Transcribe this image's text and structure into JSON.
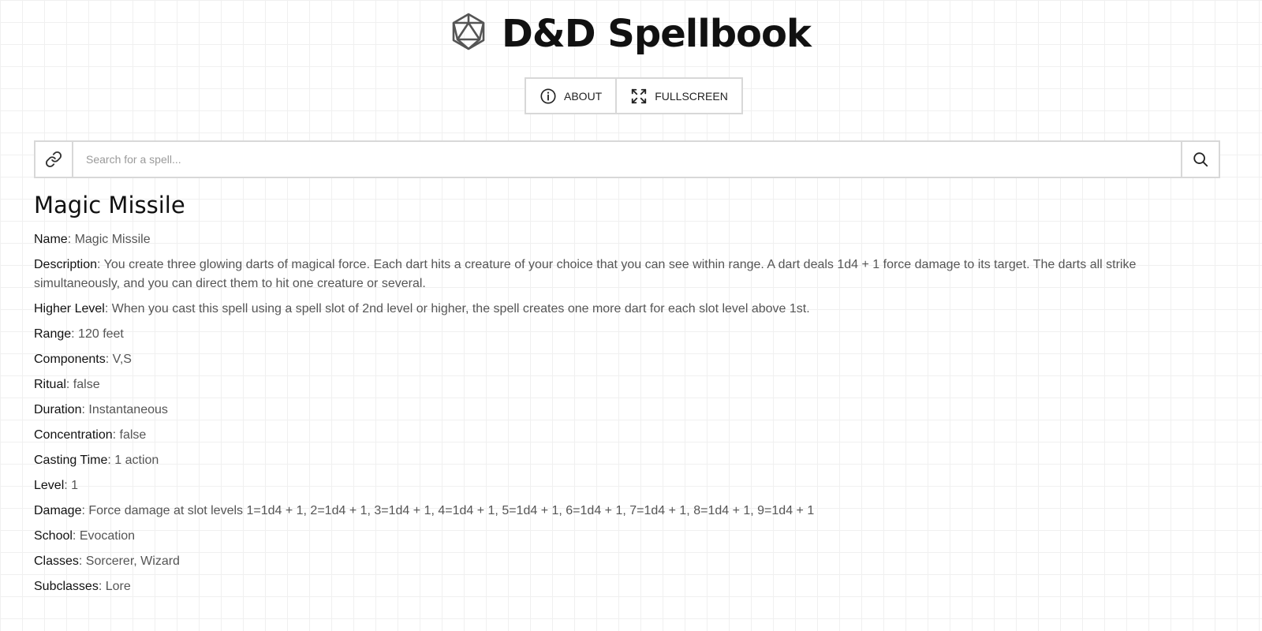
{
  "header": {
    "title": "D&D Spellbook",
    "logo_icon": "d20-icon"
  },
  "toolbar": {
    "about_label": "ABOUT",
    "about_icon": "info-icon",
    "fullscreen_label": "FULLSCREEN",
    "fullscreen_icon": "fullscreen-icon"
  },
  "search": {
    "placeholder": "Search for a spell...",
    "value": "",
    "link_icon": "link-icon",
    "search_icon": "search-icon"
  },
  "spell": {
    "title": "Magic Missile",
    "properties": [
      {
        "label": "Name",
        "value": "Magic Missile"
      },
      {
        "label": "Description",
        "value": "You create three glowing darts of magical force. Each dart hits a creature of your choice that you can see within range. A dart deals 1d4 + 1 force damage to its target. The darts all strike simultaneously, and you can direct them to hit one creature or several."
      },
      {
        "label": "Higher Level",
        "value": "When you cast this spell using a spell slot of 2nd level or higher, the spell creates one more dart for each slot level above 1st."
      },
      {
        "label": "Range",
        "value": "120 feet"
      },
      {
        "label": "Components",
        "value": "V,S"
      },
      {
        "label": "Ritual",
        "value": "false"
      },
      {
        "label": "Duration",
        "value": "Instantaneous"
      },
      {
        "label": "Concentration",
        "value": "false"
      },
      {
        "label": "Casting Time",
        "value": "1 action"
      },
      {
        "label": "Level",
        "value": "1"
      },
      {
        "label": "Damage",
        "value": "Force damage at slot levels 1=1d4 + 1, 2=1d4 + 1, 3=1d4 + 1, 4=1d4 + 1, 5=1d4 + 1, 6=1d4 + 1, 7=1d4 + 1, 8=1d4 + 1, 9=1d4 + 1"
      },
      {
        "label": "School",
        "value": "Evocation"
      },
      {
        "label": "Classes",
        "value": "Sorcerer, Wizard"
      },
      {
        "label": "Subclasses",
        "value": "Lore"
      }
    ]
  },
  "colors": {
    "text_primary": "#111111",
    "text_secondary": "#555555",
    "border": "#d8d8d8",
    "grid": "#f0f0f0"
  }
}
